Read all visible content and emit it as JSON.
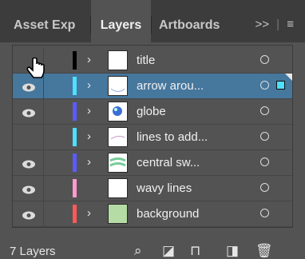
{
  "tabs": [
    {
      "label": "Asset Exp"
    },
    {
      "label": "Layers"
    },
    {
      "label": "Artboards"
    }
  ],
  "overflow_label": ">>",
  "menu_icon": "hamburger-menu-icon",
  "layers": [
    {
      "name": "title",
      "visible": false,
      "color": "#000000",
      "expandable": true,
      "thumb": "blank",
      "selected": false
    },
    {
      "name": "arrow arou...",
      "visible": true,
      "color": "#4de0ff",
      "expandable": true,
      "thumb": "arc",
      "selected": true
    },
    {
      "name": "globe",
      "visible": true,
      "color": "#5b5bff",
      "expandable": true,
      "thumb": "globe",
      "selected": false
    },
    {
      "name": "lines to add...",
      "visible": false,
      "color": "#4de0ff",
      "expandable": true,
      "thumb": "lines",
      "selected": false
    },
    {
      "name": "central sw...",
      "visible": true,
      "color": "#5b5bff",
      "expandable": true,
      "thumb": "swoosh",
      "selected": false
    },
    {
      "name": "wavy lines",
      "visible": true,
      "color": "#ff9ad0",
      "expandable": false,
      "thumb": "blank",
      "selected": false
    },
    {
      "name": "background",
      "visible": true,
      "color": "#ff5a5a",
      "expandable": true,
      "thumb": "green",
      "selected": false
    }
  ],
  "footer": {
    "count": "7 Layers",
    "icons": [
      "search-icon",
      "collect-for-export-icon",
      "make-clipping-mask-icon",
      "new-layer-icon",
      "delete-icon"
    ]
  },
  "colors": {
    "panel": "#535353",
    "tabbar": "#3c3c3c",
    "selection": "#46779d"
  }
}
